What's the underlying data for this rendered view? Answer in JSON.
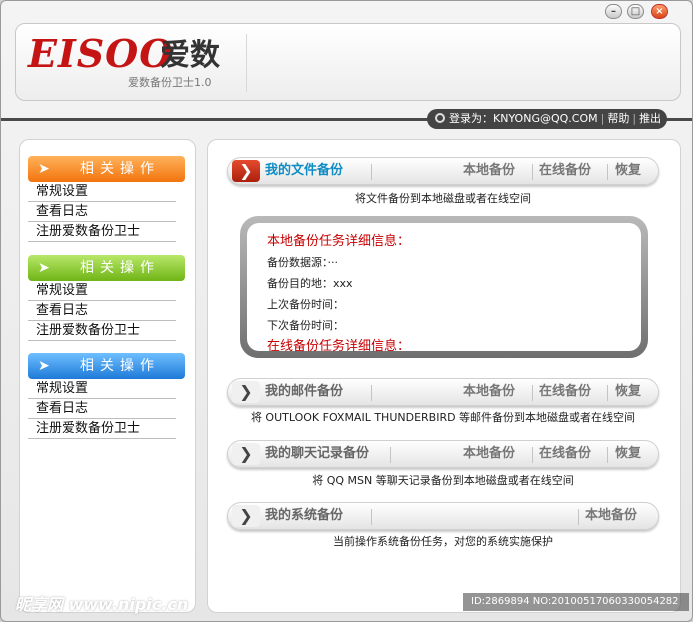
{
  "window": {
    "min_glyph": "–",
    "max_glyph": "□",
    "close_glyph": "×"
  },
  "header": {
    "logo_word": "EISOO",
    "logo_cn": "爱数",
    "subtitle": "爱数备份卫士1.0"
  },
  "userbar": {
    "login": "登录为：KNYONG@QQ.COM",
    "sep": "|",
    "help": "帮助",
    "logout": "推出"
  },
  "sidebar": {
    "groups": [
      {
        "title": "相关操作",
        "color": "orange",
        "items": [
          "常规设置",
          "查看日志",
          "注册爱数备份卫士"
        ]
      },
      {
        "title": "相关操作",
        "color": "green",
        "items": [
          "常规设置",
          "查看日志",
          "注册爱数备份卫士"
        ]
      },
      {
        "title": "相关操作",
        "color": "blue",
        "items": [
          "常规设置",
          "查看日志",
          "注册爱数备份卫士"
        ]
      }
    ],
    "arrow_glyph": "➤"
  },
  "sections": [
    {
      "title": "我的文件备份",
      "local": "本地备份",
      "online": "在线备份",
      "restore": "恢复",
      "desc": "将文件备份到本地磁盘或者在线空间",
      "chev": "❯"
    },
    {
      "title": "我的邮件备份",
      "local": "本地备份",
      "online": "在线备份",
      "restore": "恢复",
      "desc": "将 OUTLOOK FOXMAIL THUNDERBIRD 等邮件备份到本地磁盘或者在线空间",
      "chev": "❯"
    },
    {
      "title": "我的聊天记录备份",
      "local": "本地备份",
      "online": "在线备份",
      "restore": "恢复",
      "desc": "将 QQ MSN 等聊天记录备份到本地磁盘或者在线空间",
      "chev": "❯"
    },
    {
      "title": "我的系统备份",
      "local": "本地备份",
      "desc": "当前操作系统备份任务，对您的系统实施保护",
      "chev": "❯"
    }
  ],
  "detail": {
    "local_title": "本地备份任务详细信息：",
    "source": "备份数据源：···",
    "dest": "备份目的地：xxx",
    "last": "上次备份时间：",
    "next": "下次备份时间：",
    "online_title": "在线备份任务详细信息："
  },
  "watermark": {
    "text": "昵享网 www.nipic.cn",
    "id": "ID:2869894 NO:20100517060330054282"
  },
  "colors": {
    "accent_red": "#c41414",
    "link_blue": "#0e8cc4",
    "orange": "#f2740e",
    "green": "#6fb415",
    "blue": "#1e7ad8"
  }
}
